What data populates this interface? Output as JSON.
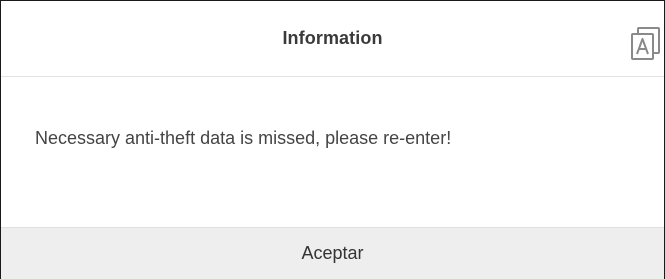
{
  "dialog": {
    "title": "Information",
    "message": "Necessary anti-theft data is missed, please re-enter!",
    "accept_label": "Aceptar",
    "header_icon": "translate-icon"
  },
  "colors": {
    "border": "#1a1a1a",
    "footer_background": "#eeeeee",
    "divider": "#e3e3e3",
    "text": "#333333",
    "icon": "#8a8a8a"
  }
}
